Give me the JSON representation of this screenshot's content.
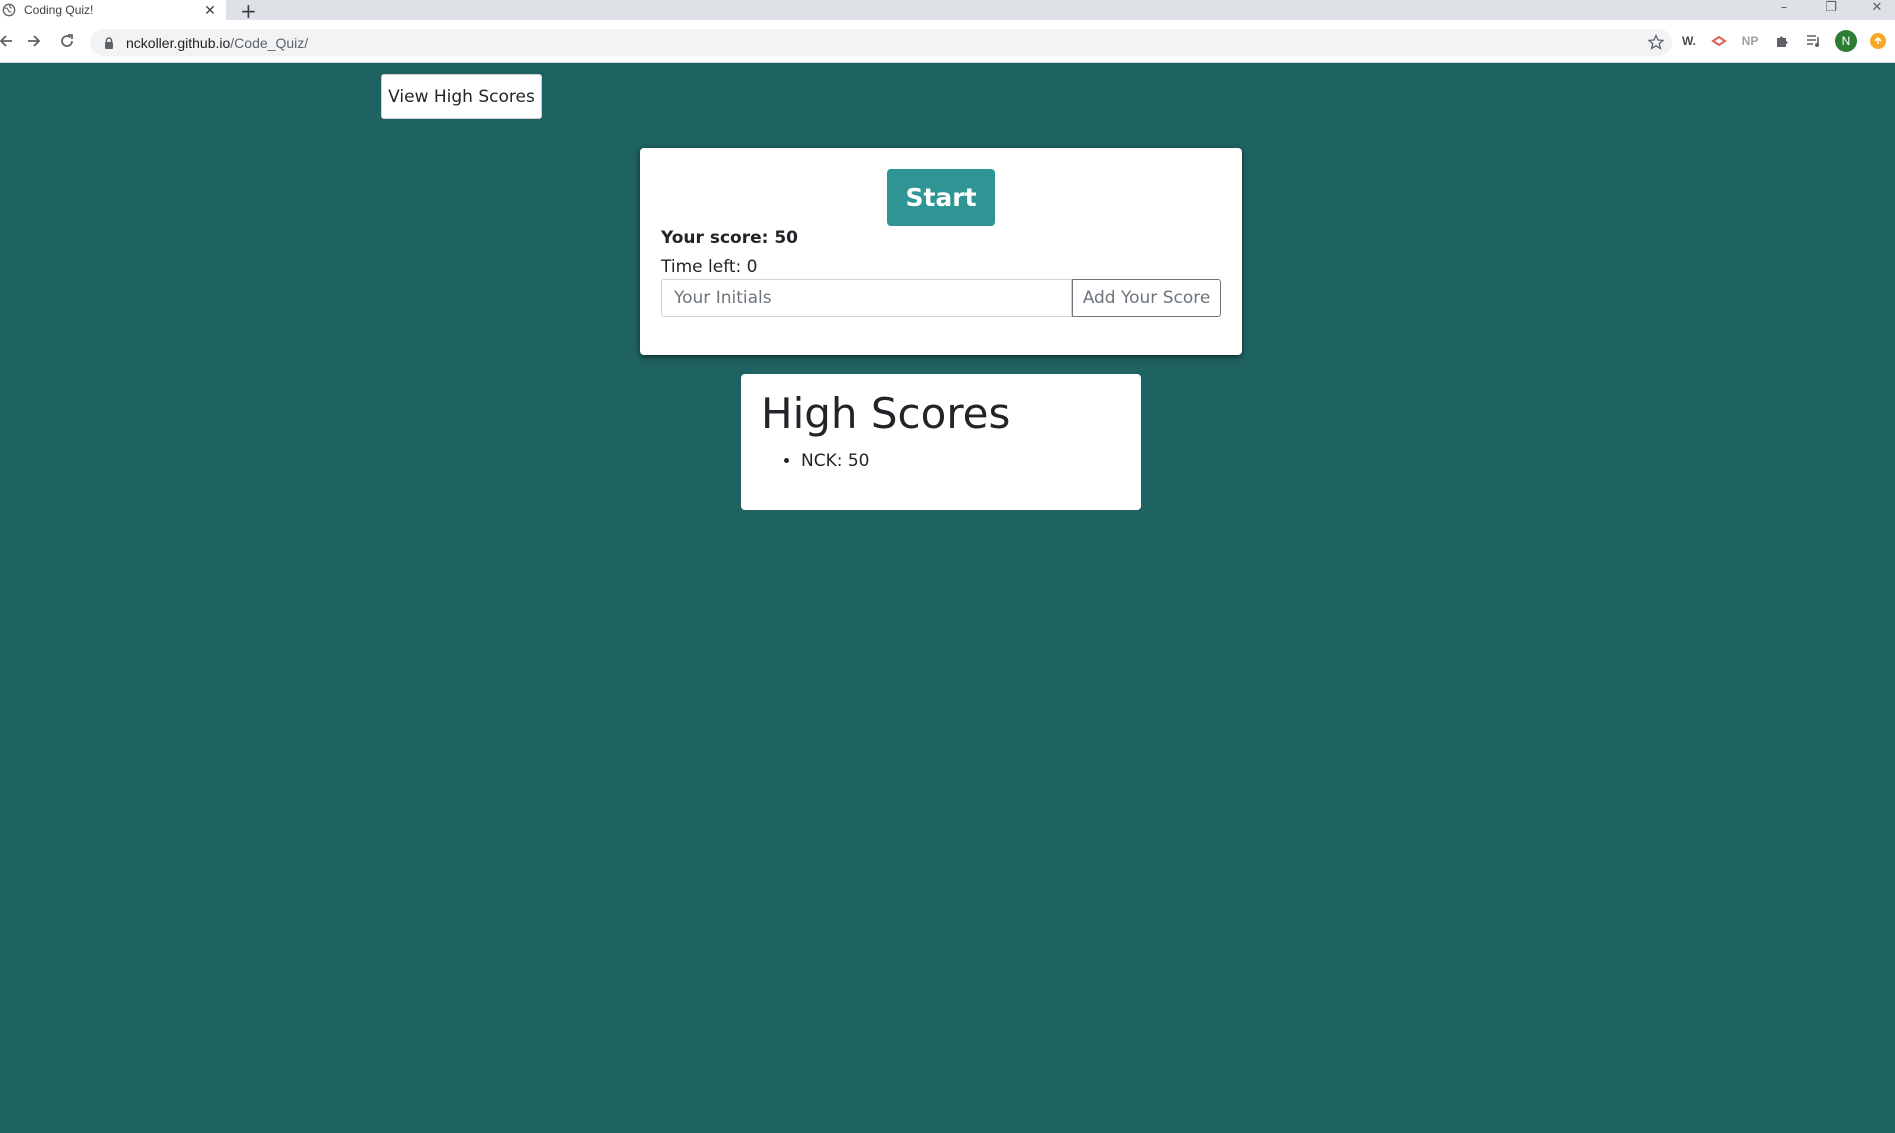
{
  "browser": {
    "tab_title": "Coding Quiz!",
    "url_host": "nckoller.github.io",
    "url_path": "/Code_Quiz/",
    "extensions": [
      {
        "name": "wordtune",
        "label": "W."
      },
      {
        "name": "cast",
        "label": ""
      },
      {
        "name": "np",
        "label": "NP"
      },
      {
        "name": "puzzle",
        "label": ""
      },
      {
        "name": "media",
        "label": ""
      },
      {
        "name": "profile",
        "label": "N"
      },
      {
        "name": "update",
        "label": ""
      }
    ]
  },
  "header": {
    "view_high_scores_label": "View High Scores"
  },
  "quiz": {
    "start_label": "Start",
    "score_text": "Your score: 50",
    "time_text": "Time left: 0",
    "initials_placeholder": "Your Initials",
    "add_score_label": "Add Your Score"
  },
  "high_scores": {
    "title": "High Scores",
    "entries": [
      "NCK: 50"
    ]
  },
  "colors": {
    "page_background": "#1f6262",
    "start_button": "#2e9494"
  }
}
